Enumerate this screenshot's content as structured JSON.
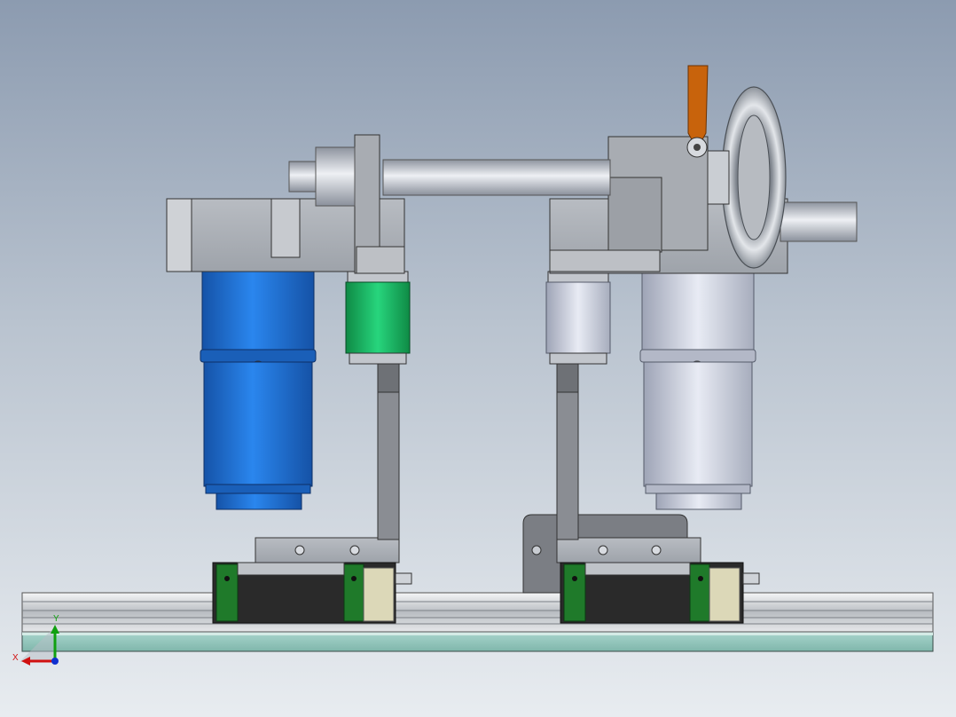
{
  "viewport": {
    "background_top": "#8c9bb0",
    "background_bottom": "#e8ecf0"
  },
  "model": {
    "description_parts": [
      "linear-guide-rail",
      "slider-block-left",
      "slider-block-right",
      "blue-servo-motor",
      "silver-servo-motor",
      "gear-housing-left",
      "gear-housing-right",
      "drive-shaft",
      "hand-wheel",
      "locking-lever",
      "green-coupling",
      "silver-coupling",
      "bracket-left",
      "bracket-right",
      "base-plate"
    ],
    "colors": {
      "motor_blue": "#1f6fd6",
      "motor_silver": "#c9cede",
      "coupling_green": "#1bbf6a",
      "lever_orange": "#c8630c",
      "carriage_green": "#1f7a2a",
      "carriage_body": "#2a2a2a",
      "base_plate": "#8fc7bd"
    }
  },
  "triad": {
    "x_label": "X",
    "y_label": "Y",
    "x_color": "#d01010",
    "y_color": "#10a010",
    "z_color": "#1030d0"
  }
}
